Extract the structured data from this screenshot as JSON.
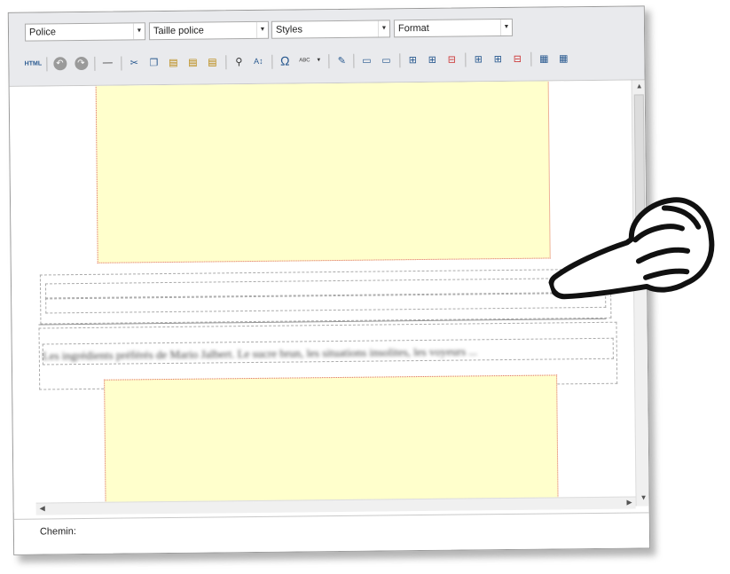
{
  "toolbar": {
    "font_select": "Police",
    "size_select": "Taille police",
    "styles_select": "Styles",
    "format_select": "Format",
    "html_label": "HTML",
    "omega": "Ω",
    "spell_label": "ABC"
  },
  "content": {
    "blurred_text": "Les ingrédients préférés de Mario Jalbert. Le sucre brun, les situations insolites, les voyeurs ..."
  },
  "status": {
    "path_label": "Chemin:"
  }
}
